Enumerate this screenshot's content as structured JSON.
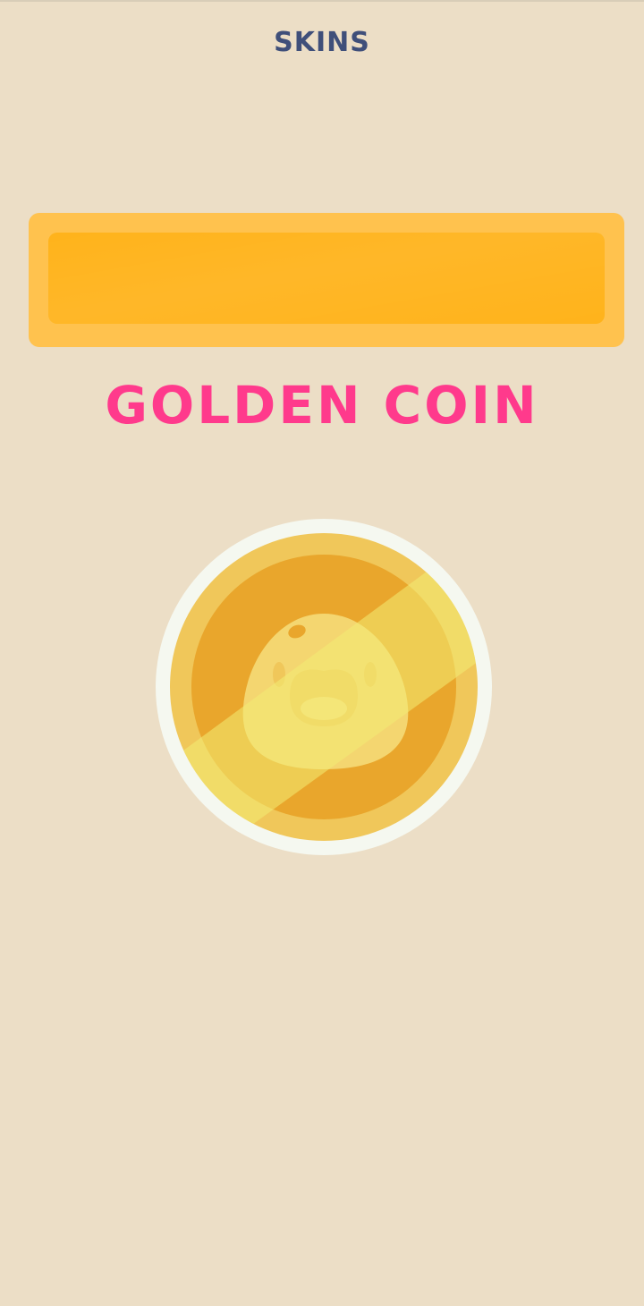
{
  "header": {
    "title": "SKINS"
  },
  "banner": {
    "color_outer": "#ffc24e",
    "color_inner": "#ffb31b"
  },
  "skin": {
    "name": "GOLDEN COIN",
    "name_color": "#ff3a8c",
    "preview_icon": "golden-coin-icon",
    "coin_colors": {
      "rim": "#f5f8f0",
      "outer": "#f0c75a",
      "inner": "#e9a62c",
      "face": "#f6de7c",
      "shine": "#f3ed74"
    }
  },
  "background_color": "#ecdec6"
}
